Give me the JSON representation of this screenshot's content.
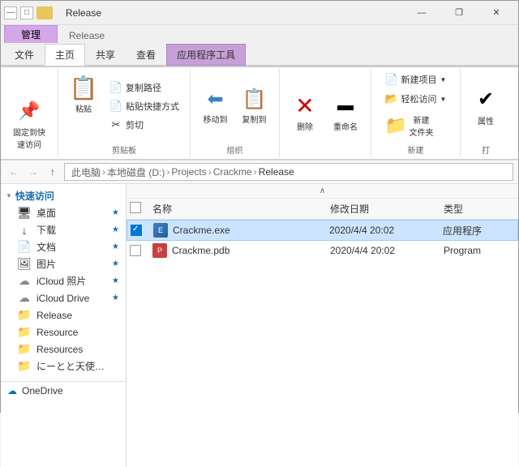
{
  "titleBar": {
    "title": "Release",
    "icons": [
      "—",
      "□",
      "⬜"
    ],
    "controls": [
      "—",
      "❐",
      "✕"
    ]
  },
  "ribbon": {
    "manageLabel": "管理",
    "releaseLabel": "Release",
    "tabs": [
      {
        "id": "file",
        "label": "文件"
      },
      {
        "id": "home",
        "label": "主页",
        "active": true
      },
      {
        "id": "share",
        "label": "共享"
      },
      {
        "id": "view",
        "label": "查看"
      },
      {
        "id": "apptools",
        "label": "应用程序工具",
        "special": true
      }
    ],
    "groups": [
      {
        "id": "quickaccess",
        "label": "固定到快速访问",
        "buttons": [
          {
            "id": "pin",
            "label": "固定到快\n速访问",
            "icon": "📌"
          }
        ]
      },
      {
        "id": "clipboard",
        "label": "剪贴板",
        "large_buttons": [
          {
            "id": "paste",
            "label": "粘贴",
            "icon": "📋"
          }
        ],
        "small_buttons": [
          {
            "id": "copy-path",
            "label": "复制路径",
            "icon": "📄"
          },
          {
            "id": "paste-shortcut",
            "label": "粘贴快捷方式",
            "icon": "📄"
          },
          {
            "id": "cut",
            "label": "剪切",
            "icon": "✂"
          }
        ]
      },
      {
        "id": "organize",
        "label": "组织",
        "buttons": [
          {
            "id": "move-to",
            "label": "移动到",
            "icon": "→"
          },
          {
            "id": "copy-to",
            "label": "复制到",
            "icon": "📋"
          }
        ]
      },
      {
        "id": "delete-rename",
        "label": "",
        "buttons": [
          {
            "id": "delete",
            "label": "删除",
            "icon": "✕"
          },
          {
            "id": "rename",
            "label": "重命名",
            "icon": "▬"
          }
        ]
      },
      {
        "id": "new",
        "label": "新建",
        "buttons": [
          {
            "id": "new-item",
            "label": "新建项目",
            "icon": "📄"
          },
          {
            "id": "easy-access",
            "label": "轻松访问",
            "icon": "📂"
          },
          {
            "id": "new-folder",
            "label": "新建\n文件夹",
            "icon": "📁"
          }
        ]
      },
      {
        "id": "open",
        "label": "打",
        "buttons": [
          {
            "id": "properties",
            "label": "属性",
            "icon": "ℹ"
          }
        ]
      }
    ]
  },
  "addressBar": {
    "back": "←",
    "forward": "→",
    "up": "↑",
    "refresh": "↻",
    "path": [
      "此电脑",
      "本地磁盘 (D:)",
      "Projects",
      "Crackme",
      "Release"
    ]
  },
  "sidebar": {
    "quickAccess": {
      "label": "快速访问",
      "items": [
        {
          "id": "desktop",
          "label": "桌面",
          "icon": "🖥",
          "pinned": true
        },
        {
          "id": "downloads",
          "label": "下载",
          "icon": "↓",
          "pinned": true
        },
        {
          "id": "documents",
          "label": "文档",
          "icon": "📄",
          "pinned": true
        },
        {
          "id": "pictures",
          "label": "图片",
          "icon": "🖼",
          "pinned": true
        },
        {
          "id": "icloud-photos",
          "label": "iCloud 照片",
          "icon": "☁",
          "pinned": true
        },
        {
          "id": "icloud-drive",
          "label": "iCloud Drive",
          "icon": "☁",
          "pinned": true
        },
        {
          "id": "release",
          "label": "Release",
          "icon": "📁",
          "pinned": false
        },
        {
          "id": "resource",
          "label": "Resource",
          "icon": "📁",
          "pinned": false
        },
        {
          "id": "resources",
          "label": "Resources",
          "icon": "📁",
          "pinned": false
        },
        {
          "id": "niito",
          "label": "にーとと天使とえ",
          "icon": "📁",
          "pinned": false
        }
      ]
    },
    "oneDrive": {
      "label": "OneDrive",
      "icon": "☁"
    }
  },
  "fileList": {
    "columns": [
      {
        "id": "name",
        "label": "名称"
      },
      {
        "id": "date",
        "label": "修改日期"
      },
      {
        "id": "type",
        "label": "类型"
      }
    ],
    "files": [
      {
        "id": "crackme-exe",
        "name": "Crackme.exe",
        "date": "2020/4/4 20:02",
        "type": "应用程序",
        "iconType": "exe",
        "selected": true,
        "checked": true
      },
      {
        "id": "crackme-pdb",
        "name": "Crackme.pdb",
        "date": "2020/4/4 20:02",
        "type": "Program",
        "iconType": "pdb",
        "selected": false,
        "checked": false
      }
    ]
  }
}
